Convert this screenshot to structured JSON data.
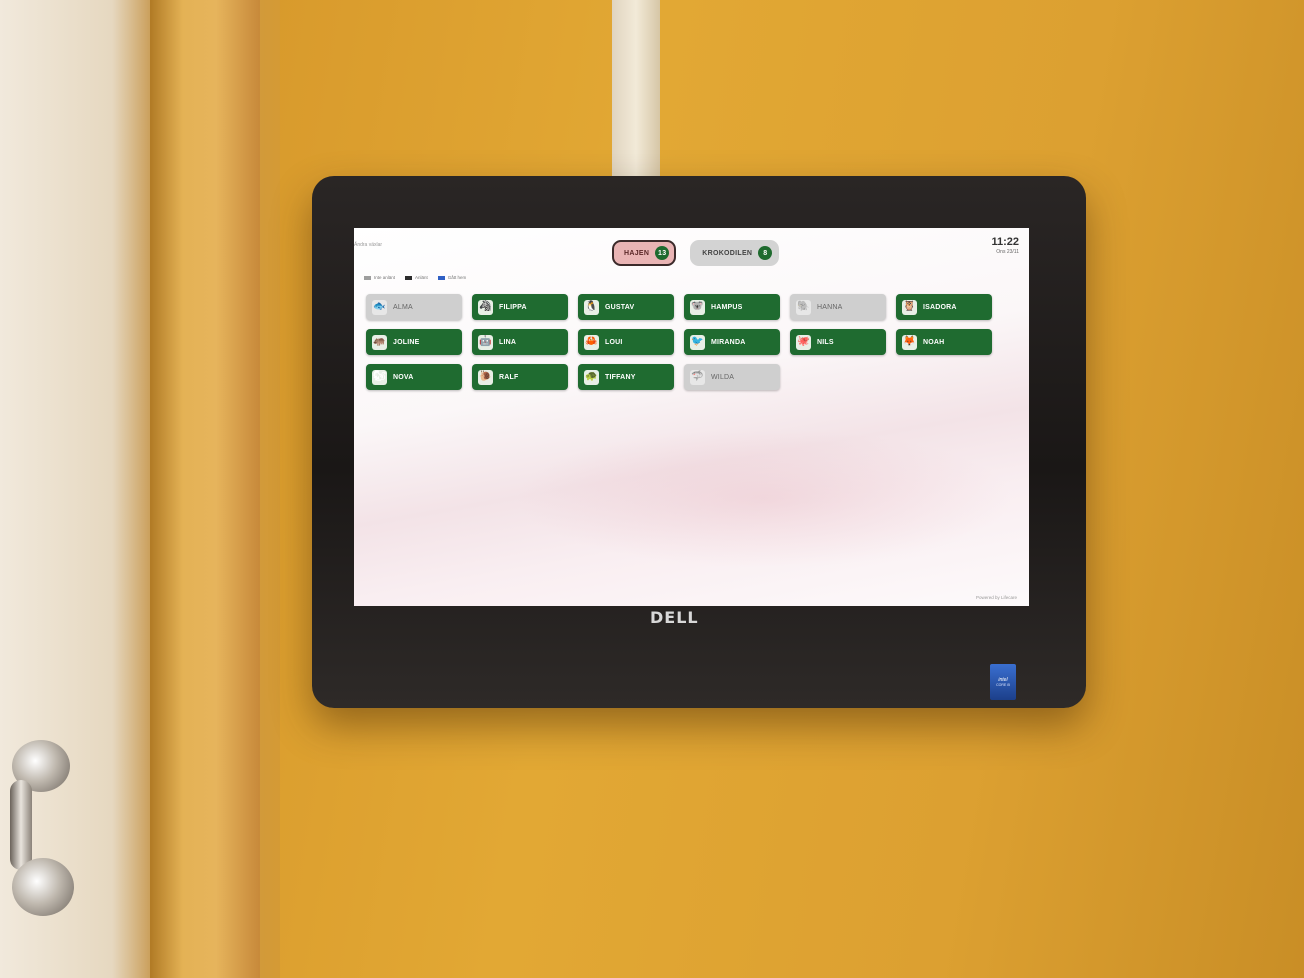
{
  "top_left_link": "Ändra växlar",
  "legend": [
    {
      "label": "Inte anlänt",
      "color": "#9e9e9e"
    },
    {
      "label": "Anlänt",
      "color": "#2c2c2c"
    },
    {
      "label": "Gått hem",
      "color": "#2f5fc4"
    }
  ],
  "groups": [
    {
      "name": "HAJEN",
      "count": "13",
      "active": true
    },
    {
      "name": "KROKODILEN",
      "count": "8",
      "active": false
    }
  ],
  "clock": {
    "time": "11:22",
    "date": "Ons 23/11"
  },
  "children": [
    {
      "name": "ALMA",
      "icon": "fish-icon",
      "glyph": "🐟",
      "status": "absent"
    },
    {
      "name": "FILIPPA",
      "icon": "zebra-icon",
      "glyph": "🦓",
      "status": "present"
    },
    {
      "name": "GUSTAV",
      "icon": "penguin-icon",
      "glyph": "🐧",
      "status": "present"
    },
    {
      "name": "HAMPUS",
      "icon": "koala-icon",
      "glyph": "🐨",
      "status": "present"
    },
    {
      "name": "HANNA",
      "icon": "elephant-icon",
      "glyph": "🐘",
      "status": "absent"
    },
    {
      "name": "ISADORA",
      "icon": "owl-icon",
      "glyph": "🦉",
      "status": "present"
    },
    {
      "name": "JOLINE",
      "icon": "hippo-icon",
      "glyph": "🦛",
      "status": "present"
    },
    {
      "name": "LINA",
      "icon": "robot-icon",
      "glyph": "🤖",
      "status": "present"
    },
    {
      "name": "LOUI",
      "icon": "crab-icon",
      "glyph": "🦀",
      "status": "present"
    },
    {
      "name": "MIRANDA",
      "icon": "bird-icon",
      "glyph": "🐦",
      "status": "present"
    },
    {
      "name": "NILS",
      "icon": "octopus-icon",
      "glyph": "🐙",
      "status": "present"
    },
    {
      "name": "NOAH",
      "icon": "fox-icon",
      "glyph": "🦊",
      "status": "present"
    },
    {
      "name": "NOVA",
      "icon": "squirrel-icon",
      "glyph": "🐿",
      "status": "present"
    },
    {
      "name": "RALF",
      "icon": "snail-icon",
      "glyph": "🐌",
      "status": "present"
    },
    {
      "name": "TIFFANY",
      "icon": "turtle-icon",
      "glyph": "🐢",
      "status": "present"
    },
    {
      "name": "WILDA",
      "icon": "shark-icon",
      "glyph": "🦈",
      "status": "absent"
    }
  ],
  "powered_by": "Powered by Lifecare",
  "monitor_brand": "DELL",
  "sticker": {
    "logo": "intel",
    "sub": "CORE i5"
  }
}
